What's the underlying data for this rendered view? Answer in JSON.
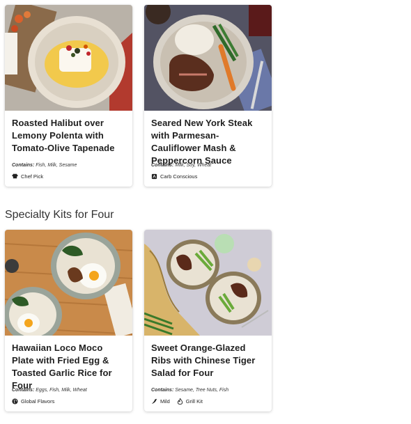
{
  "section": {
    "title": "Specialty Kits for Four"
  },
  "cards": [
    {
      "title": "Roasted Halibut over Lemony Polenta with Tomato-Olive Tapenade",
      "contains_label": "Contains:",
      "contains": "Fish, Milk, Sesame",
      "tags": [
        {
          "icon": "chef-hat-icon",
          "label": "Chef Pick"
        }
      ]
    },
    {
      "title": "Seared New York Steak with Parmesan-Cauliflower Mash & Peppercorn Sauce",
      "contains_label": "Contains:",
      "contains": "Milk, Soy, Wheat",
      "tags": [
        {
          "icon": "carb-conscious-icon",
          "label": "Carb Conscious"
        }
      ]
    },
    {
      "title": "Hawaiian Loco Moco Plate with Fried Egg & Toasted Garlic Rice for Four",
      "contains_label": "Contains:",
      "contains": "Eggs, Fish, Milk, Wheat",
      "tags": [
        {
          "icon": "globe-icon",
          "label": "Global Flavors"
        }
      ]
    },
    {
      "title": "Sweet Orange-Glazed Ribs with Chinese Tiger Salad for Four",
      "contains_label": "Contains:",
      "contains": "Sesame, Tree Nuts, Fish",
      "tags": [
        {
          "icon": "pepper-icon",
          "label": "Mild"
        },
        {
          "icon": "flame-icon",
          "label": "Grill Kit"
        }
      ]
    }
  ]
}
